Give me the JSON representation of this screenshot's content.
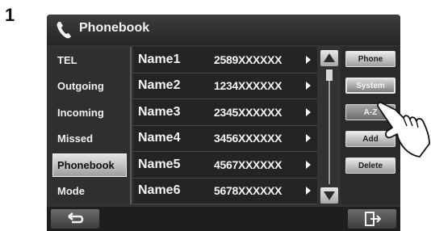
{
  "step_number": "1",
  "title_bar": {
    "title": "Phonebook",
    "icon": "phone-handset-icon"
  },
  "sidebar": {
    "items": [
      {
        "label": "TEL",
        "selected": false
      },
      {
        "label": "Outgoing",
        "selected": false
      },
      {
        "label": "Incoming",
        "selected": false
      },
      {
        "label": "Missed",
        "selected": false
      },
      {
        "label": "Phonebook",
        "selected": true
      },
      {
        "label": "Mode",
        "selected": false
      }
    ]
  },
  "contacts": [
    {
      "name": "Name1",
      "number": "2589XXXXXX"
    },
    {
      "name": "Name2",
      "number": "1234XXXXXX"
    },
    {
      "name": "Name3",
      "number": "2345XXXXXX"
    },
    {
      "name": "Name4",
      "number": "3456XXXXXX"
    },
    {
      "name": "Name5",
      "number": "4567XXXXXX"
    },
    {
      "name": "Name6",
      "number": "5678XXXXXX"
    }
  ],
  "right_buttons": {
    "phone": "Phone",
    "system": "System",
    "az": "A-Z",
    "add": "Add",
    "delete": "Delete"
  },
  "bottom_bar": {
    "back_icon": "return-arrow-icon",
    "exit_icon": "exit-icon"
  },
  "colors": {
    "screen_bg": "#333333",
    "selected_item": "#c8c8c8",
    "text": "#f4f4f4"
  }
}
